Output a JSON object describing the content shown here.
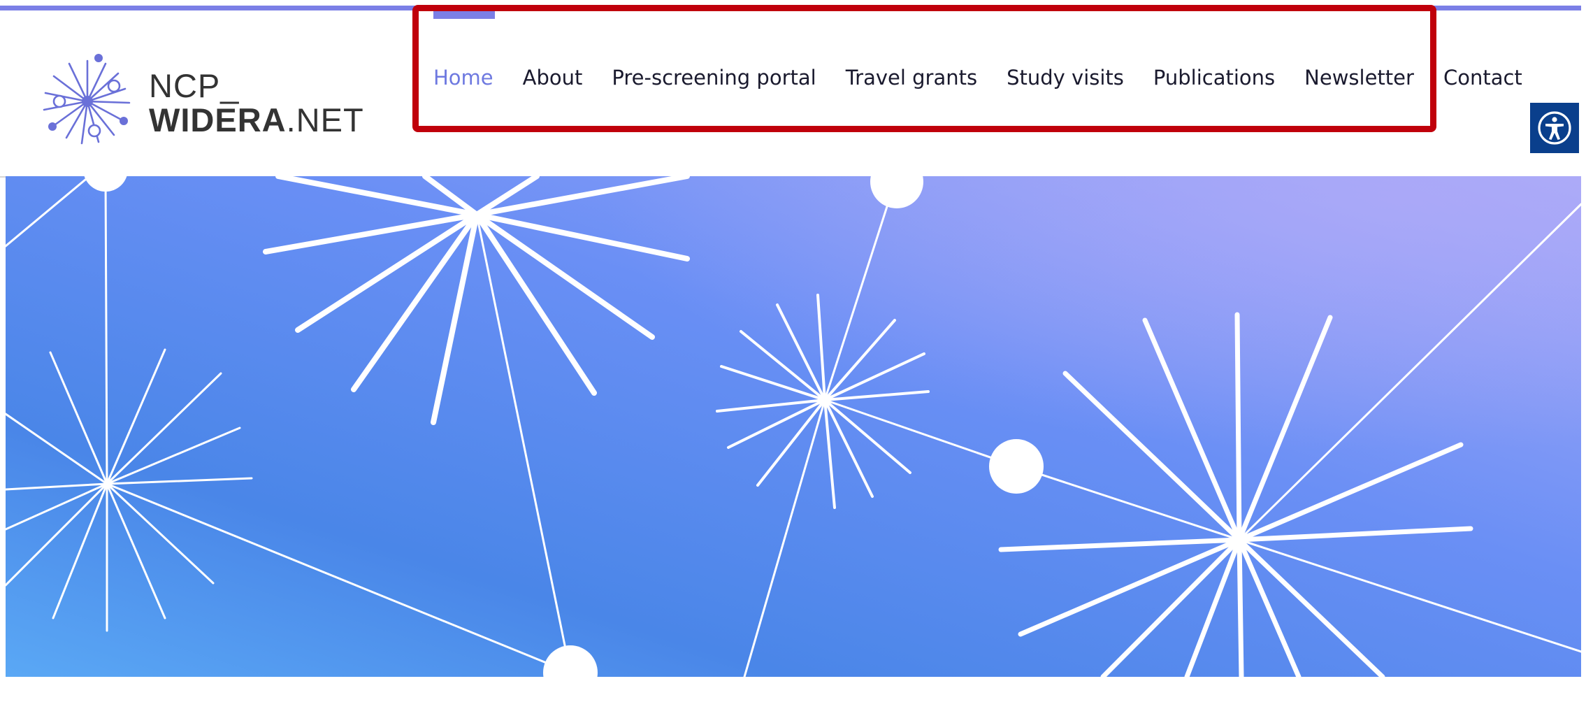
{
  "brand": {
    "logo_line1": "NCP_",
    "logo_line2_bold": "WIDERA",
    "logo_line2_regular": ".NET",
    "accent_color": "#7b7fe6"
  },
  "nav": {
    "items": [
      {
        "label": "Home",
        "active": true
      },
      {
        "label": "About",
        "active": false
      },
      {
        "label": "Pre-screening portal",
        "active": false
      },
      {
        "label": "Travel grants",
        "active": false
      },
      {
        "label": "Study visits",
        "active": false
      },
      {
        "label": "Publications",
        "active": false
      },
      {
        "label": "Newsletter",
        "active": false
      },
      {
        "label": "Contact",
        "active": false
      }
    ],
    "active_color": "#6e79e0",
    "text_color": "#1a1a2e"
  },
  "highlight": {
    "color": "#c0000b",
    "target": "main navigation"
  },
  "accessibility": {
    "icon": "accessibility-person-icon",
    "color": "#0a3f8c"
  },
  "hero": {
    "decoration": "network-starburst-pattern",
    "gradient_colors": [
      "#4a86e8",
      "#6a8ff5",
      "#a8aaf8"
    ]
  }
}
